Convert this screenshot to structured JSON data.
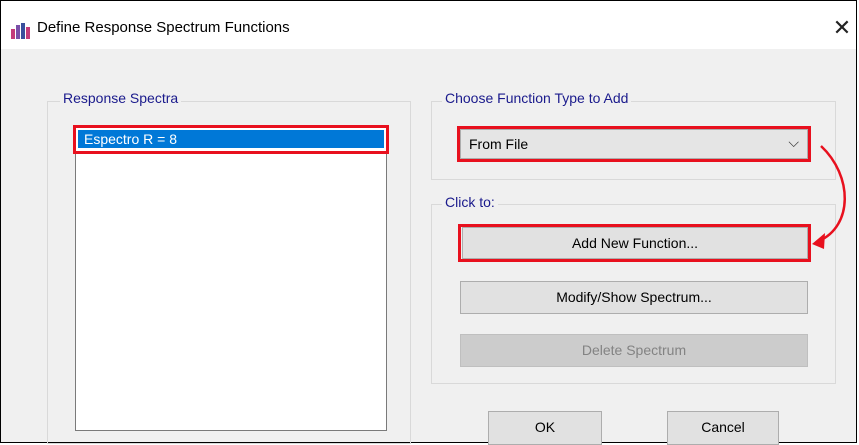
{
  "window": {
    "title": "Define Response Spectrum Functions",
    "close_glyph": "✕"
  },
  "response_spectra": {
    "group_label": "Response Spectra",
    "items": [
      "Espectro R = 8"
    ],
    "selected": "Espectro R = 8"
  },
  "function_type": {
    "group_label": "Choose  Function Type to Add",
    "selected_value": "From File",
    "caret": "⌵"
  },
  "click_to": {
    "group_label": "Click to:",
    "add_new": "Add New Function...",
    "modify_show": "Modify/Show Spectrum...",
    "delete": "Delete Spectrum"
  },
  "footer": {
    "ok": "OK",
    "cancel": "Cancel"
  },
  "colors": {
    "highlight": "#e8101e",
    "selection": "#0078d7",
    "group_label": "#1a1a8c"
  }
}
